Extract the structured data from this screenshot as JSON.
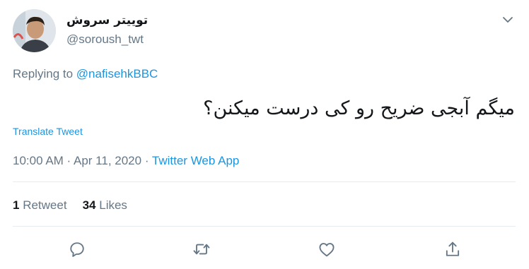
{
  "author": {
    "display_name": "توییتر سروش",
    "handle": "@soroush_twt"
  },
  "reply": {
    "prefix": "Replying to ",
    "to_handle": "@nafisehkBBC"
  },
  "tweet": {
    "text": "میگم آبجی ضریح رو کی درست میکنن؟",
    "translate_label": "Translate Tweet"
  },
  "meta": {
    "time": "10:00 AM",
    "sep1": " · ",
    "date": "Apr 11, 2020",
    "sep2": " · ",
    "source": "Twitter Web App"
  },
  "stats": {
    "retweets_count": "1",
    "retweets_label": "Retweet",
    "likes_count": "34",
    "likes_label": "Likes"
  },
  "actions": {
    "icons": [
      "reply-icon",
      "retweet-icon",
      "like-icon",
      "share-icon"
    ]
  },
  "colors": {
    "link": "#1b95e0",
    "secondary_text": "#657786",
    "primary_text": "#14171a",
    "divider": "#e6ecf0"
  }
}
